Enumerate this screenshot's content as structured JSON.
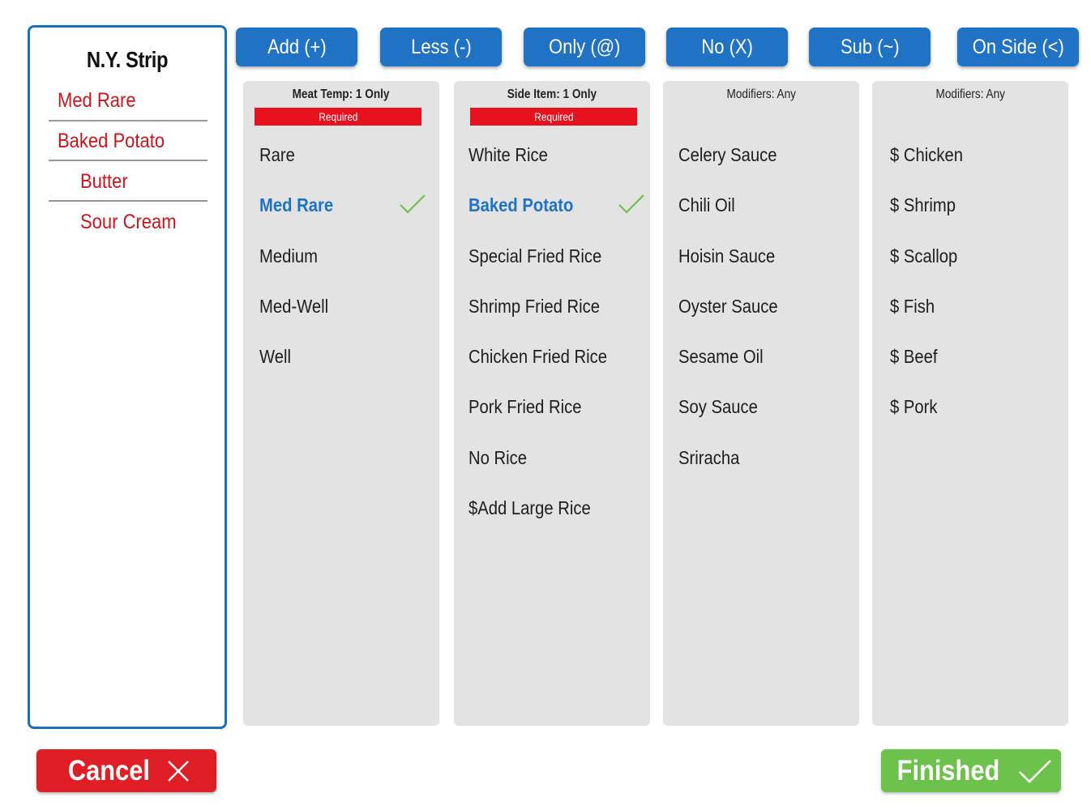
{
  "order": {
    "title": "N.Y. Strip",
    "lines": [
      {
        "label": "Med Rare"
      },
      {
        "label": "Baked Potato"
      },
      {
        "label": "Butter"
      },
      {
        "label": "Sour Cream"
      }
    ]
  },
  "modifier_buttons": [
    "Add (+)",
    "Less (-)",
    "Only (@)",
    "No (X)",
    "Sub (~)",
    "On Side (<)"
  ],
  "columns": [
    {
      "header": "Meat Temp: 1 Only",
      "required_label": "Required",
      "options": [
        "Rare",
        "Med Rare",
        "Medium",
        "Med-Well",
        "Well"
      ],
      "selected": "Med Rare"
    },
    {
      "header": "Side Item: 1 Only",
      "required_label": "Required",
      "options": [
        "White Rice",
        "Baked Potato",
        "Special Fried Rice",
        "Shrimp Fried Rice",
        "Chicken Fried Rice",
        "Pork Fried Rice",
        "No Rice",
        "$Add Large Rice"
      ],
      "selected": "Baked Potato"
    },
    {
      "header": "Modifiers: Any",
      "options": [
        "Celery Sauce",
        "Chili Oil",
        "Hoisin Sauce",
        "Oyster Sauce",
        "Sesame Oil",
        "Soy Sauce",
        "Sriracha"
      ]
    },
    {
      "header": "Modifiers: Any",
      "options": [
        "$ Chicken",
        "$ Shrimp",
        "$ Scallop",
        "$ Fish",
        "$ Beef",
        "$ Pork"
      ]
    }
  ],
  "actions": {
    "cancel_label": "Cancel",
    "finished_label": "Finished"
  },
  "icons": {
    "check": "check-icon",
    "close": "close-icon"
  },
  "colors": {
    "brand_blue": "#1f72c4",
    "required_red": "#e8121e",
    "order_red": "#c8161d",
    "cancel_red": "#e01e26",
    "finished_green": "#6cc24a",
    "check_green": "#6cc24a"
  }
}
